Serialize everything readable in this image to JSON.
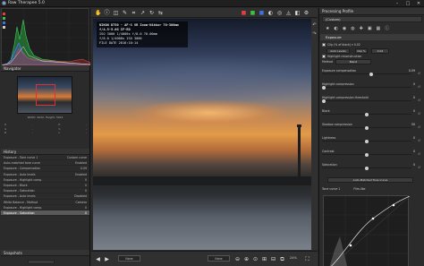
{
  "window": {
    "title": "Raw Therapee 5.0"
  },
  "colors": {
    "accent": "#e03030",
    "panel": "#2b2b2b",
    "track": "#1d1d1d"
  },
  "navigator": {
    "title": "Navigator",
    "info": "Width: 4032, Height: 3024",
    "values": [
      [
        "R",
        "-",
        "H",
        "-"
      ],
      [
        "G",
        "-",
        "S",
        "-"
      ],
      [
        "B",
        "-",
        "L",
        "-"
      ]
    ]
  },
  "history": {
    "title": "History",
    "items": [
      {
        "label": "Exposure - Tone curve 1",
        "value": "Custom curve"
      },
      {
        "label": "Auto-matched tone curve",
        "value": "Enabled"
      },
      {
        "label": "Exposure - Compensation",
        "value": "0.09"
      },
      {
        "label": "Exposure - Auto levels",
        "value": "Enabled"
      },
      {
        "label": "Exposure - Highlight comp.",
        "value": "0"
      },
      {
        "label": "Exposure - Black",
        "value": "0"
      },
      {
        "label": "Exposure - Saturation",
        "value": "0"
      },
      {
        "label": "Exposure - Auto levels",
        "value": "Disabled"
      },
      {
        "label": "White Balance - Method",
        "value": "Camera"
      },
      {
        "label": "Exposure - Highlight comp.",
        "value": "0"
      },
      {
        "label": "Exposure - Saturation",
        "value": "0"
      }
    ],
    "selected_index": 10
  },
  "snapshots": {
    "title": "Snapshots"
  },
  "exif": {
    "line1": "NIKON D750 - AF-S VR Zoom-Nikkor 70-300mm f/4.5-5.6G IF-ED",
    "line2": "ISO 3000  1/4000s  f/8.0  70.00mm",
    "line3": "f/8.0  1/4000s  ISO 3000",
    "line4": "FILE DATE 2016:10:14"
  },
  "bottombar": {
    "left_select": "None",
    "right_select": "None",
    "zoom": "24%"
  },
  "right_panel": {
    "title": "Processing Profile",
    "profile": "(Custom)",
    "exposure_title": "Exposure",
    "clip_label": "Clip (% of black) ▾ 0.02",
    "auto_levels": "Auto Levels",
    "clip": "Clip %",
    "clip_value": "0.02",
    "highlight_recon": "Highlight reconstruction",
    "method_label": "Method",
    "method_value": "Blend",
    "sliders": [
      {
        "label": "Exposure compensation",
        "value": "0.09",
        "pos": 0.55
      },
      {
        "label": "Highlight compression",
        "value": "0",
        "pos": 0.0
      },
      {
        "label": "Highlight compression threshold",
        "value": "0",
        "pos": 0.0
      },
      {
        "label": "Black",
        "value": "0",
        "pos": 0.5
      },
      {
        "label": "Shadow compression",
        "value": "50",
        "pos": 0.5
      },
      {
        "label": "Lightness",
        "value": "0",
        "pos": 0.5
      },
      {
        "label": "Contrast",
        "value": "0",
        "pos": 0.5
      },
      {
        "label": "Saturation",
        "value": "0",
        "pos": 0.5
      }
    ],
    "auto_matched": "Auto-Matched Tone Curve",
    "curve_label": "Tone curve 1",
    "curve_mode": "Film-like"
  }
}
